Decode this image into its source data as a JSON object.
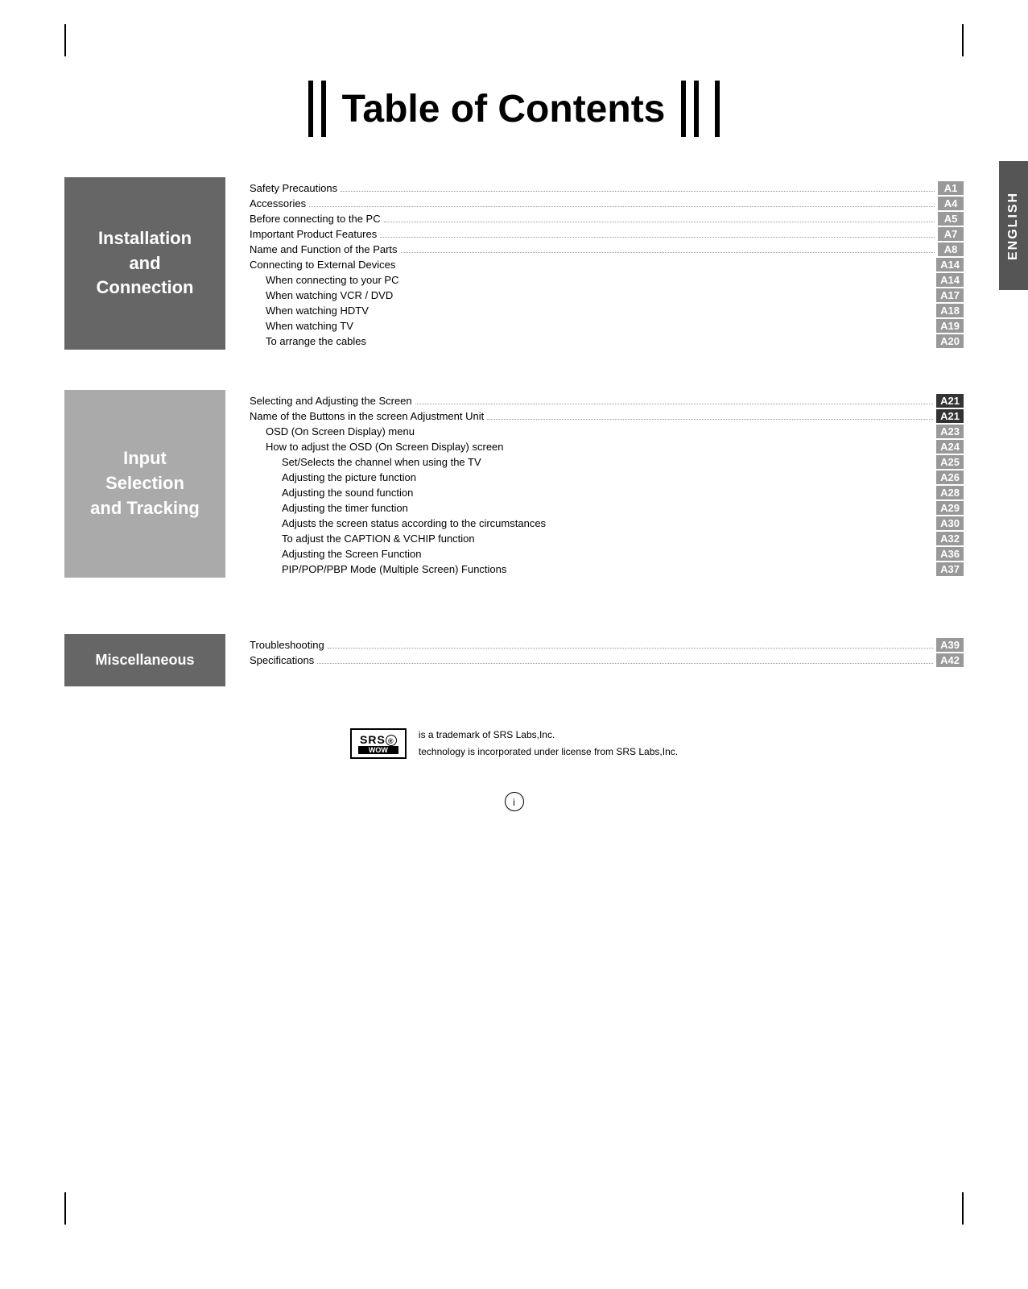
{
  "title": "Table of Contents",
  "english_tab": "ENGLISH",
  "sections": [
    {
      "id": "installation",
      "label": "Installation\nand\nConnection",
      "label_shade": "dark",
      "entries": [
        {
          "text": "Safety Precautions",
          "indent": 0,
          "bold": false,
          "page": "A1",
          "dots": true
        },
        {
          "text": "Accessories",
          "indent": 0,
          "bold": false,
          "page": "A4",
          "dots": true
        },
        {
          "text": "Before connecting to the PC",
          "indent": 0,
          "bold": false,
          "page": "A5",
          "dots": true
        },
        {
          "text": "Important Product Features",
          "indent": 0,
          "bold": false,
          "page": "A7",
          "dots": true
        },
        {
          "text": "Name and Function of the Parts",
          "indent": 0,
          "bold": false,
          "page": "A8",
          "dots": true
        },
        {
          "text": "Connecting to External Devices",
          "indent": 0,
          "bold": false,
          "page": "A14",
          "dots": false
        },
        {
          "text": "When connecting to your PC",
          "indent": 1,
          "bold": false,
          "page": "A14",
          "dots": false
        },
        {
          "text": "When watching VCR / DVD",
          "indent": 1,
          "bold": false,
          "page": "A17",
          "dots": false
        },
        {
          "text": "When watching HDTV",
          "indent": 1,
          "bold": false,
          "page": "A18",
          "dots": false
        },
        {
          "text": "When watching TV",
          "indent": 1,
          "bold": false,
          "page": "A19",
          "dots": false
        },
        {
          "text": "To arrange the cables",
          "indent": 1,
          "bold": false,
          "page": "A20",
          "dots": false
        }
      ]
    },
    {
      "id": "input",
      "label": "Input\nSelection\nand Tracking",
      "label_shade": "light",
      "entries": [
        {
          "text": "Selecting and Adjusting the Screen",
          "indent": 0,
          "bold": false,
          "page": "A21",
          "dots": true,
          "highlight": true
        },
        {
          "text": "Name of the Buttons in the screen Adjustment Unit",
          "indent": 0,
          "bold": false,
          "page": "A21",
          "dots": true,
          "highlight": true
        },
        {
          "text": "OSD (On Screen Display) menu",
          "indent": 1,
          "bold": false,
          "page": "A23",
          "dots": false
        },
        {
          "text": "How to adjust the OSD (On Screen Display) screen",
          "indent": 1,
          "bold": false,
          "page": "A24",
          "dots": false
        },
        {
          "text": "Set/Selects the channel when using the TV",
          "indent": 2,
          "bold": false,
          "page": "A25",
          "dots": false
        },
        {
          "text": "Adjusting the picture function",
          "indent": 2,
          "bold": false,
          "page": "A26",
          "dots": false
        },
        {
          "text": "Adjusting the sound function",
          "indent": 2,
          "bold": false,
          "page": "A28",
          "dots": false
        },
        {
          "text": "Adjusting the timer function",
          "indent": 2,
          "bold": false,
          "page": "A29",
          "dots": false
        },
        {
          "text": "Adjusts the screen status according to the circumstances",
          "indent": 2,
          "bold": false,
          "page": "A30",
          "dots": false
        },
        {
          "text": "To adjust the CAPTION & VCHIP function",
          "indent": 2,
          "bold": false,
          "page": "A32",
          "dots": false
        },
        {
          "text": "Adjusting the Screen Function",
          "indent": 2,
          "bold": false,
          "page": "A36",
          "dots": false
        },
        {
          "text": "PIP/POP/PBP Mode (Multiple Screen) Functions",
          "indent": 2,
          "bold": false,
          "page": "A37",
          "dots": false
        }
      ]
    },
    {
      "id": "miscellaneous",
      "label": "Miscellaneous",
      "label_shade": "dark",
      "entries": [
        {
          "text": "Troubleshooting",
          "indent": 0,
          "bold": false,
          "page": "A39",
          "dots": true
        },
        {
          "text": "Specifications",
          "indent": 0,
          "bold": false,
          "page": "A42",
          "dots": true
        }
      ]
    }
  ],
  "trademark": {
    "line1": "is a trademark of SRS Labs,Inc.",
    "line2": "technology is incorporated under license from SRS Labs,Inc."
  },
  "page_number": "i"
}
